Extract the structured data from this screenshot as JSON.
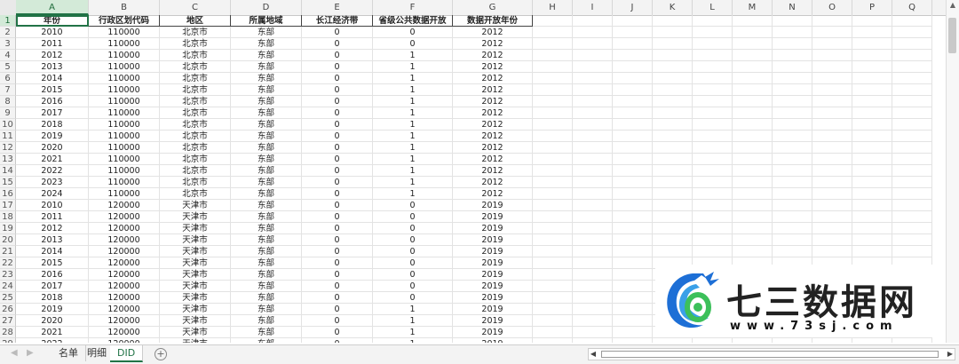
{
  "columns": [
    "A",
    "B",
    "C",
    "D",
    "E",
    "F",
    "G",
    "H",
    "I",
    "J",
    "K",
    "L",
    "M",
    "N",
    "O",
    "P",
    "Q"
  ],
  "selected_column": "A",
  "header_row": {
    "row_num": "1",
    "cells": [
      "年份",
      "行政区划代码",
      "地区",
      "所属地域",
      "长江经济带",
      "省级公共数据开放",
      "数据开放年份"
    ]
  },
  "rows": [
    {
      "row_num": "2",
      "cells": [
        "2010",
        "110000",
        "北京市",
        "东部",
        "0",
        "0",
        "2012"
      ]
    },
    {
      "row_num": "3",
      "cells": [
        "2011",
        "110000",
        "北京市",
        "东部",
        "0",
        "0",
        "2012"
      ]
    },
    {
      "row_num": "4",
      "cells": [
        "2012",
        "110000",
        "北京市",
        "东部",
        "0",
        "1",
        "2012"
      ]
    },
    {
      "row_num": "5",
      "cells": [
        "2013",
        "110000",
        "北京市",
        "东部",
        "0",
        "1",
        "2012"
      ]
    },
    {
      "row_num": "6",
      "cells": [
        "2014",
        "110000",
        "北京市",
        "东部",
        "0",
        "1",
        "2012"
      ]
    },
    {
      "row_num": "7",
      "cells": [
        "2015",
        "110000",
        "北京市",
        "东部",
        "0",
        "1",
        "2012"
      ]
    },
    {
      "row_num": "8",
      "cells": [
        "2016",
        "110000",
        "北京市",
        "东部",
        "0",
        "1",
        "2012"
      ]
    },
    {
      "row_num": "9",
      "cells": [
        "2017",
        "110000",
        "北京市",
        "东部",
        "0",
        "1",
        "2012"
      ]
    },
    {
      "row_num": "10",
      "cells": [
        "2018",
        "110000",
        "北京市",
        "东部",
        "0",
        "1",
        "2012"
      ]
    },
    {
      "row_num": "11",
      "cells": [
        "2019",
        "110000",
        "北京市",
        "东部",
        "0",
        "1",
        "2012"
      ]
    },
    {
      "row_num": "12",
      "cells": [
        "2020",
        "110000",
        "北京市",
        "东部",
        "0",
        "1",
        "2012"
      ]
    },
    {
      "row_num": "13",
      "cells": [
        "2021",
        "110000",
        "北京市",
        "东部",
        "0",
        "1",
        "2012"
      ]
    },
    {
      "row_num": "14",
      "cells": [
        "2022",
        "110000",
        "北京市",
        "东部",
        "0",
        "1",
        "2012"
      ]
    },
    {
      "row_num": "15",
      "cells": [
        "2023",
        "110000",
        "北京市",
        "东部",
        "0",
        "1",
        "2012"
      ]
    },
    {
      "row_num": "16",
      "cells": [
        "2024",
        "110000",
        "北京市",
        "东部",
        "0",
        "1",
        "2012"
      ]
    },
    {
      "row_num": "17",
      "cells": [
        "2010",
        "120000",
        "天津市",
        "东部",
        "0",
        "0",
        "2019"
      ]
    },
    {
      "row_num": "18",
      "cells": [
        "2011",
        "120000",
        "天津市",
        "东部",
        "0",
        "0",
        "2019"
      ]
    },
    {
      "row_num": "19",
      "cells": [
        "2012",
        "120000",
        "天津市",
        "东部",
        "0",
        "0",
        "2019"
      ]
    },
    {
      "row_num": "20",
      "cells": [
        "2013",
        "120000",
        "天津市",
        "东部",
        "0",
        "0",
        "2019"
      ]
    },
    {
      "row_num": "21",
      "cells": [
        "2014",
        "120000",
        "天津市",
        "东部",
        "0",
        "0",
        "2019"
      ]
    },
    {
      "row_num": "22",
      "cells": [
        "2015",
        "120000",
        "天津市",
        "东部",
        "0",
        "0",
        "2019"
      ]
    },
    {
      "row_num": "23",
      "cells": [
        "2016",
        "120000",
        "天津市",
        "东部",
        "0",
        "0",
        "2019"
      ]
    },
    {
      "row_num": "24",
      "cells": [
        "2017",
        "120000",
        "天津市",
        "东部",
        "0",
        "0",
        "2019"
      ]
    },
    {
      "row_num": "25",
      "cells": [
        "2018",
        "120000",
        "天津市",
        "东部",
        "0",
        "0",
        "2019"
      ]
    },
    {
      "row_num": "26",
      "cells": [
        "2019",
        "120000",
        "天津市",
        "东部",
        "0",
        "1",
        "2019"
      ]
    },
    {
      "row_num": "27",
      "cells": [
        "2020",
        "120000",
        "天津市",
        "东部",
        "0",
        "1",
        "2019"
      ]
    },
    {
      "row_num": "28",
      "cells": [
        "2021",
        "120000",
        "天津市",
        "东部",
        "0",
        "1",
        "2019"
      ]
    },
    {
      "row_num": "29",
      "cells": [
        "2022",
        "120000",
        "天津市",
        "东部",
        "0",
        "1",
        "2019"
      ]
    }
  ],
  "sheet_tabs": [
    "名单",
    "明细",
    "DID"
  ],
  "active_tab": "DID",
  "watermark": {
    "brand": "七三数据网",
    "url": "www.73sj.com"
  },
  "colors": {
    "accent": "#217346",
    "logo_blue": "#1d6fd6",
    "logo_green": "#3cc05a"
  }
}
